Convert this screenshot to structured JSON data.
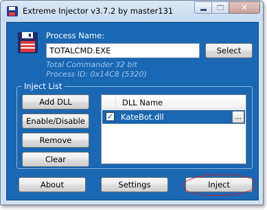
{
  "window": {
    "title": "Extreme Injector v3.7.2 by master131",
    "controls": {
      "minimize": "–",
      "maximize": "□",
      "close": "✕"
    }
  },
  "process": {
    "label": "Process Name:",
    "value": "TOTALCMD.EXE",
    "select_label": "Select",
    "info_name": "Total Commander 32 bit",
    "info_id": "Process ID: 0x14C8 (5320)"
  },
  "inject_list": {
    "title": "Inject List",
    "buttons": {
      "add": "Add DLL",
      "enable": "Enable/Disable",
      "remove": "Remove",
      "clear": "Clear"
    },
    "column_header": "DLL Name",
    "rows": [
      {
        "checked": true,
        "name": "KateBot.dll",
        "more": "..."
      }
    ]
  },
  "footer": {
    "about": "About",
    "settings": "Settings",
    "inject": "Inject"
  },
  "colors": {
    "client_background": "#1a67b3",
    "title_bar": "#cfe0f2",
    "info_text": "#9fc4ea",
    "annotation_circle": "#c8202c"
  },
  "icons": {
    "app": "floppy-disk-icon",
    "checkbox": "check-icon"
  }
}
